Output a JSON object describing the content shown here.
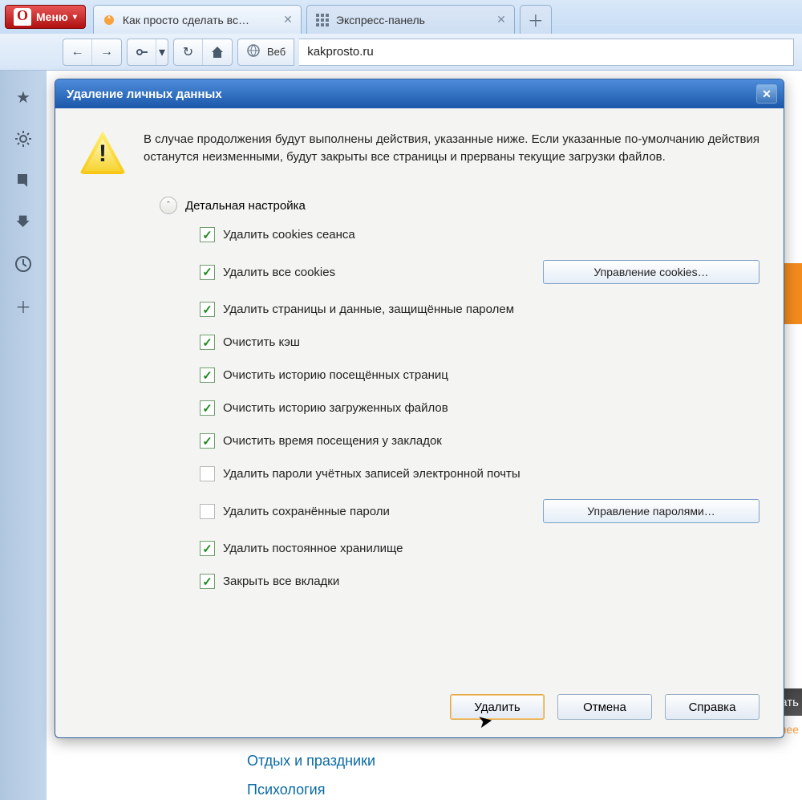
{
  "menu": {
    "label": "Меню"
  },
  "tabs": [
    {
      "title": "Как просто сделать вс…"
    },
    {
      "title": "Экспресс-панель"
    }
  ],
  "address": {
    "scope": "Веб",
    "url": "kakprosto.ru"
  },
  "page": {
    "link1": "Отдых и праздники",
    "link2": "Психология",
    "side1": "ать",
    "side2": "нее"
  },
  "dialog": {
    "title": "Удаление личных данных",
    "message": "В случае продолжения будут выполнены действия, указанные ниже. Если указанные по-умолчанию действия останутся неизменными, будут закрыты все страницы и прерваны текущие загрузки файлов.",
    "detail_header": "Детальная настройка",
    "options": [
      {
        "label": "Удалить cookies сеанса",
        "checked": true
      },
      {
        "label": "Удалить все cookies",
        "checked": true,
        "button": "Управление cookies…"
      },
      {
        "label": "Удалить страницы и данные, защищённые паролем",
        "checked": true
      },
      {
        "label": "Очистить кэш",
        "checked": true
      },
      {
        "label": "Очистить историю посещённых страниц",
        "checked": true
      },
      {
        "label": "Очистить историю загруженных файлов",
        "checked": true
      },
      {
        "label": "Очистить время посещения у закладок",
        "checked": true
      },
      {
        "label": "Удалить пароли учётных записей электронной почты",
        "checked": false
      },
      {
        "label": "Удалить сохранённые пароли",
        "checked": false,
        "button": "Управление паролями…"
      },
      {
        "label": "Удалить постоянное хранилище",
        "checked": true
      },
      {
        "label": "Закрыть все вкладки",
        "checked": true
      }
    ],
    "buttons": {
      "delete": "Удалить",
      "cancel": "Отмена",
      "help": "Справка"
    }
  }
}
